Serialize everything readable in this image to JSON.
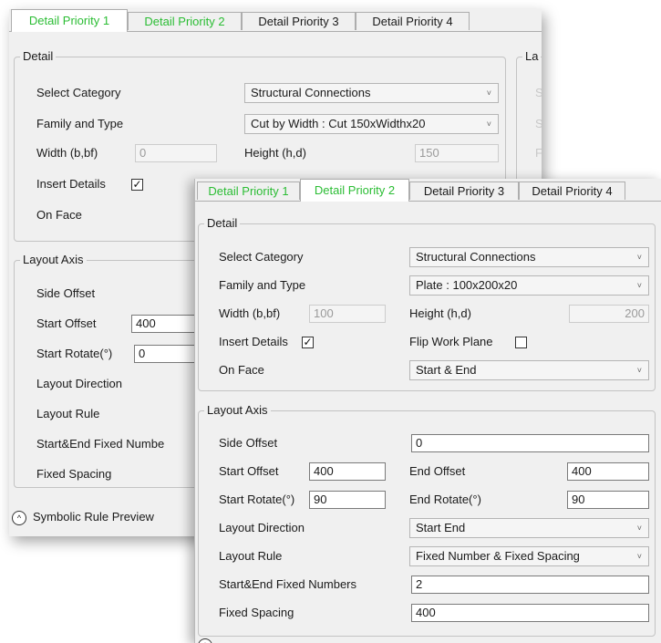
{
  "tabs": [
    "Detail Priority 1",
    "Detail Priority 2",
    "Detail Priority 3",
    "Detail Priority 4"
  ],
  "back": {
    "detail_group": "Detail",
    "right_group_partial": "La",
    "right_partial_labels": [
      "S",
      "S",
      "F"
    ],
    "select_category_label": "Select Category",
    "select_category_value": "Structural Connections",
    "family_type_label": "Family and Type",
    "family_type_value": "Cut by Width : Cut 150xWidthx20",
    "width_label": "Width (b,bf)",
    "width_value": "0",
    "height_label": "Height (h,d)",
    "height_value": "150",
    "insert_details_label": "Insert Details",
    "insert_details_checked": true,
    "on_face_label": "On Face",
    "layout_group": "Layout Axis",
    "side_offset_label": "Side Offset",
    "start_offset_label": "Start Offset",
    "start_offset_value": "400",
    "start_rotate_label": "Start Rotate(°)",
    "start_rotate_value": "0",
    "layout_direction_label": "Layout Direction",
    "layout_rule_label": "Layout Rule",
    "fixed_numbers_label": "Start&End Fixed Numbe",
    "fixed_spacing_label": "Fixed Spacing",
    "symbolic_preview_label": "Symbolic Rule Preview"
  },
  "front": {
    "detail_group": "Detail",
    "select_category_label": "Select Category",
    "select_category_value": "Structural Connections",
    "family_type_label": "Family and Type",
    "family_type_value": "Plate : 100x200x20",
    "width_label": "Width (b,bf)",
    "width_value": "100",
    "height_label": "Height (h,d)",
    "height_value": "200",
    "insert_details_label": "Insert Details",
    "insert_details_checked": true,
    "flip_work_plane_label": "Flip Work Plane",
    "flip_work_plane_checked": false,
    "on_face_label": "On Face",
    "on_face_value": "Start & End",
    "layout_group": "Layout Axis",
    "side_offset_label": "Side Offset",
    "side_offset_value": "0",
    "start_offset_label": "Start Offset",
    "start_offset_value": "400",
    "end_offset_label": "End Offset",
    "end_offset_value": "400",
    "start_rotate_label": "Start Rotate(°)",
    "start_rotate_value": "90",
    "end_rotate_label": "End Rotate(°)",
    "end_rotate_value": "90",
    "layout_direction_label": "Layout Direction",
    "layout_direction_value": "Start End",
    "layout_rule_label": "Layout Rule",
    "layout_rule_value": "Fixed Number & Fixed Spacing",
    "fixed_numbers_label": "Start&End Fixed Numbers",
    "fixed_numbers_value": "2",
    "fixed_spacing_label": "Fixed Spacing",
    "fixed_spacing_value": "400"
  },
  "glyphs": {
    "check": "✓",
    "dropdown": "˅",
    "expand": "^"
  },
  "colors": {
    "tab_modified": "#2bbd34",
    "panel_bg": "#f0f0f0"
  }
}
